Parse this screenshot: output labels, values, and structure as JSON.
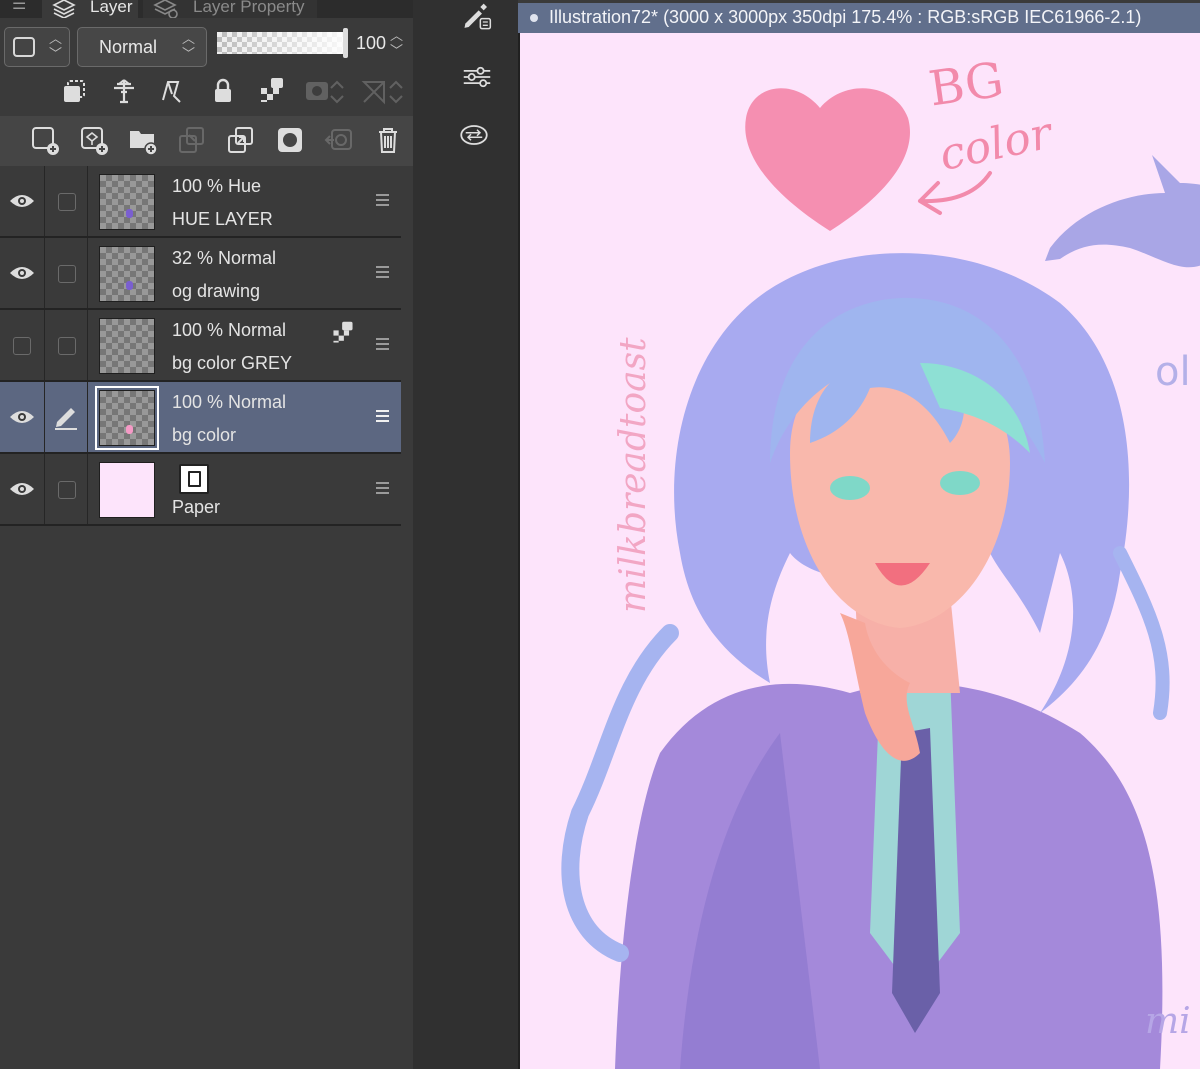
{
  "panel": {
    "tabs": [
      {
        "label": "Layer"
      },
      {
        "label": "Layer Property"
      }
    ],
    "blend_mode": "Normal",
    "opacity_value": "100"
  },
  "layers": [
    {
      "mode": "100 %  Hue",
      "name": "HUE LAYER",
      "visible": true
    },
    {
      "mode": "32 %  Normal",
      "name": "og drawing",
      "visible": true
    },
    {
      "mode": "100 %  Normal",
      "name": "bg color GREY",
      "visible": false
    },
    {
      "mode": "100 %  Normal",
      "name": "bg color",
      "visible": true,
      "selected": true
    },
    {
      "name": "Paper",
      "visible": true
    }
  ],
  "canvas": {
    "tab_title": "Illustration72* (3000 x 3000px 350dpi 175.4% : RGB:sRGB IEC61966-2.1)",
    "background_color": "#fde4fb",
    "annotation_bg": "BG",
    "annotation_color": "color",
    "signature": "milkbreadtoast",
    "signature_corner": "mi",
    "edge_text": "ol"
  },
  "colors": {
    "accent_selected": "#5c6781",
    "canvas_tab": "#616f8c",
    "heart": "#f58fb1",
    "dolphin": "#a9a6e6"
  }
}
